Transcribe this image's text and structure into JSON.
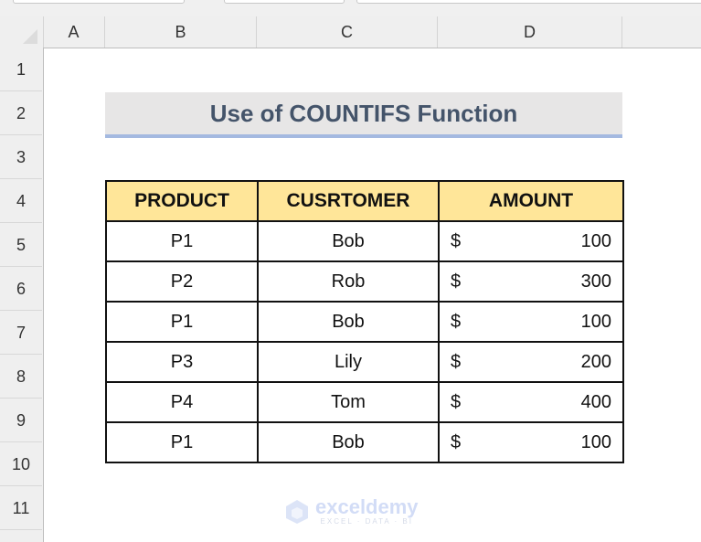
{
  "sheet": {
    "columns": [
      "A",
      "B",
      "C",
      "D"
    ],
    "rows": [
      "1",
      "2",
      "3",
      "4",
      "5",
      "6",
      "7",
      "8",
      "9",
      "10",
      "11"
    ],
    "title": "Use of COUNTIFS Function",
    "table": {
      "headers": [
        "PRODUCT",
        "CUSRTOMER",
        "AMOUNT"
      ],
      "rows": [
        {
          "product": "P1",
          "customer": "Bob",
          "currency": "$",
          "amount": "100"
        },
        {
          "product": "P2",
          "customer": "Rob",
          "currency": "$",
          "amount": "300"
        },
        {
          "product": "P1",
          "customer": "Bob",
          "currency": "$",
          "amount": "100"
        },
        {
          "product": "P3",
          "customer": "Lily",
          "currency": "$",
          "amount": "200"
        },
        {
          "product": "P4",
          "customer": "Tom",
          "currency": "$",
          "amount": "400"
        },
        {
          "product": "P1",
          "customer": "Bob",
          "currency": "$",
          "amount": "100"
        }
      ]
    }
  },
  "watermark": {
    "name": "exceldemy",
    "tagline": "EXCEL · DATA · BI",
    "icon": "exceldemy-logo-icon"
  },
  "colors": {
    "header_fill": "#ffe699",
    "title_fill": "#e7e6e6",
    "title_text": "#44546a",
    "title_underline": "#a4b9e0"
  }
}
